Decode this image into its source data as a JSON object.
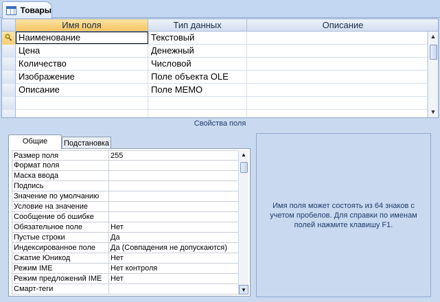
{
  "tab": {
    "title": "Товары",
    "icon": "table-icon"
  },
  "grid": {
    "columns": [
      "Имя поля",
      "Тип данных",
      "Описание"
    ],
    "rows": [
      {
        "name": "Наименование",
        "type": "Текстовый",
        "description": "",
        "primary_key": true
      },
      {
        "name": "Цена",
        "type": "Денежный",
        "description": ""
      },
      {
        "name": "Количество",
        "type": "Числовой",
        "description": ""
      },
      {
        "name": "Изображение",
        "type": "Поле объекта OLE",
        "description": ""
      },
      {
        "name": "Описание",
        "type": "Поле MEMO",
        "description": ""
      },
      {
        "name": "",
        "type": "",
        "description": ""
      },
      {
        "name": "",
        "type": "",
        "description": ""
      }
    ]
  },
  "properties": {
    "section_label": "Свойства поля",
    "tabs": {
      "general": "Общие",
      "lookup": "Подстановка"
    },
    "rows": [
      {
        "label": "Размер поля",
        "value": "255"
      },
      {
        "label": "Формат поля",
        "value": ""
      },
      {
        "label": "Маска ввода",
        "value": ""
      },
      {
        "label": "Подпись",
        "value": ""
      },
      {
        "label": "Значение по умолчанию",
        "value": ""
      },
      {
        "label": "Условие на значение",
        "value": ""
      },
      {
        "label": "Сообщение об ошибке",
        "value": ""
      },
      {
        "label": "Обязательное поле",
        "value": "Нет"
      },
      {
        "label": "Пустые строки",
        "value": "Да"
      },
      {
        "label": "Индексированное поле",
        "value": "Да (Совпадения не допускаются)"
      },
      {
        "label": "Сжатие Юникод",
        "value": "Нет"
      },
      {
        "label": "Режим IME",
        "value": "Нет контроля"
      },
      {
        "label": "Режим предложений IME",
        "value": "Нет"
      },
      {
        "label": "Смарт-теги",
        "value": ""
      }
    ]
  },
  "help_text": "Имя поля может состоять из 64 знаков с учетом пробелов.  Для справки по именам полей нажмите клавишу F1.",
  "colors": {
    "accent_header": "#f6c55f",
    "background": "#c9d9ef",
    "border": "#8fa9d0"
  }
}
